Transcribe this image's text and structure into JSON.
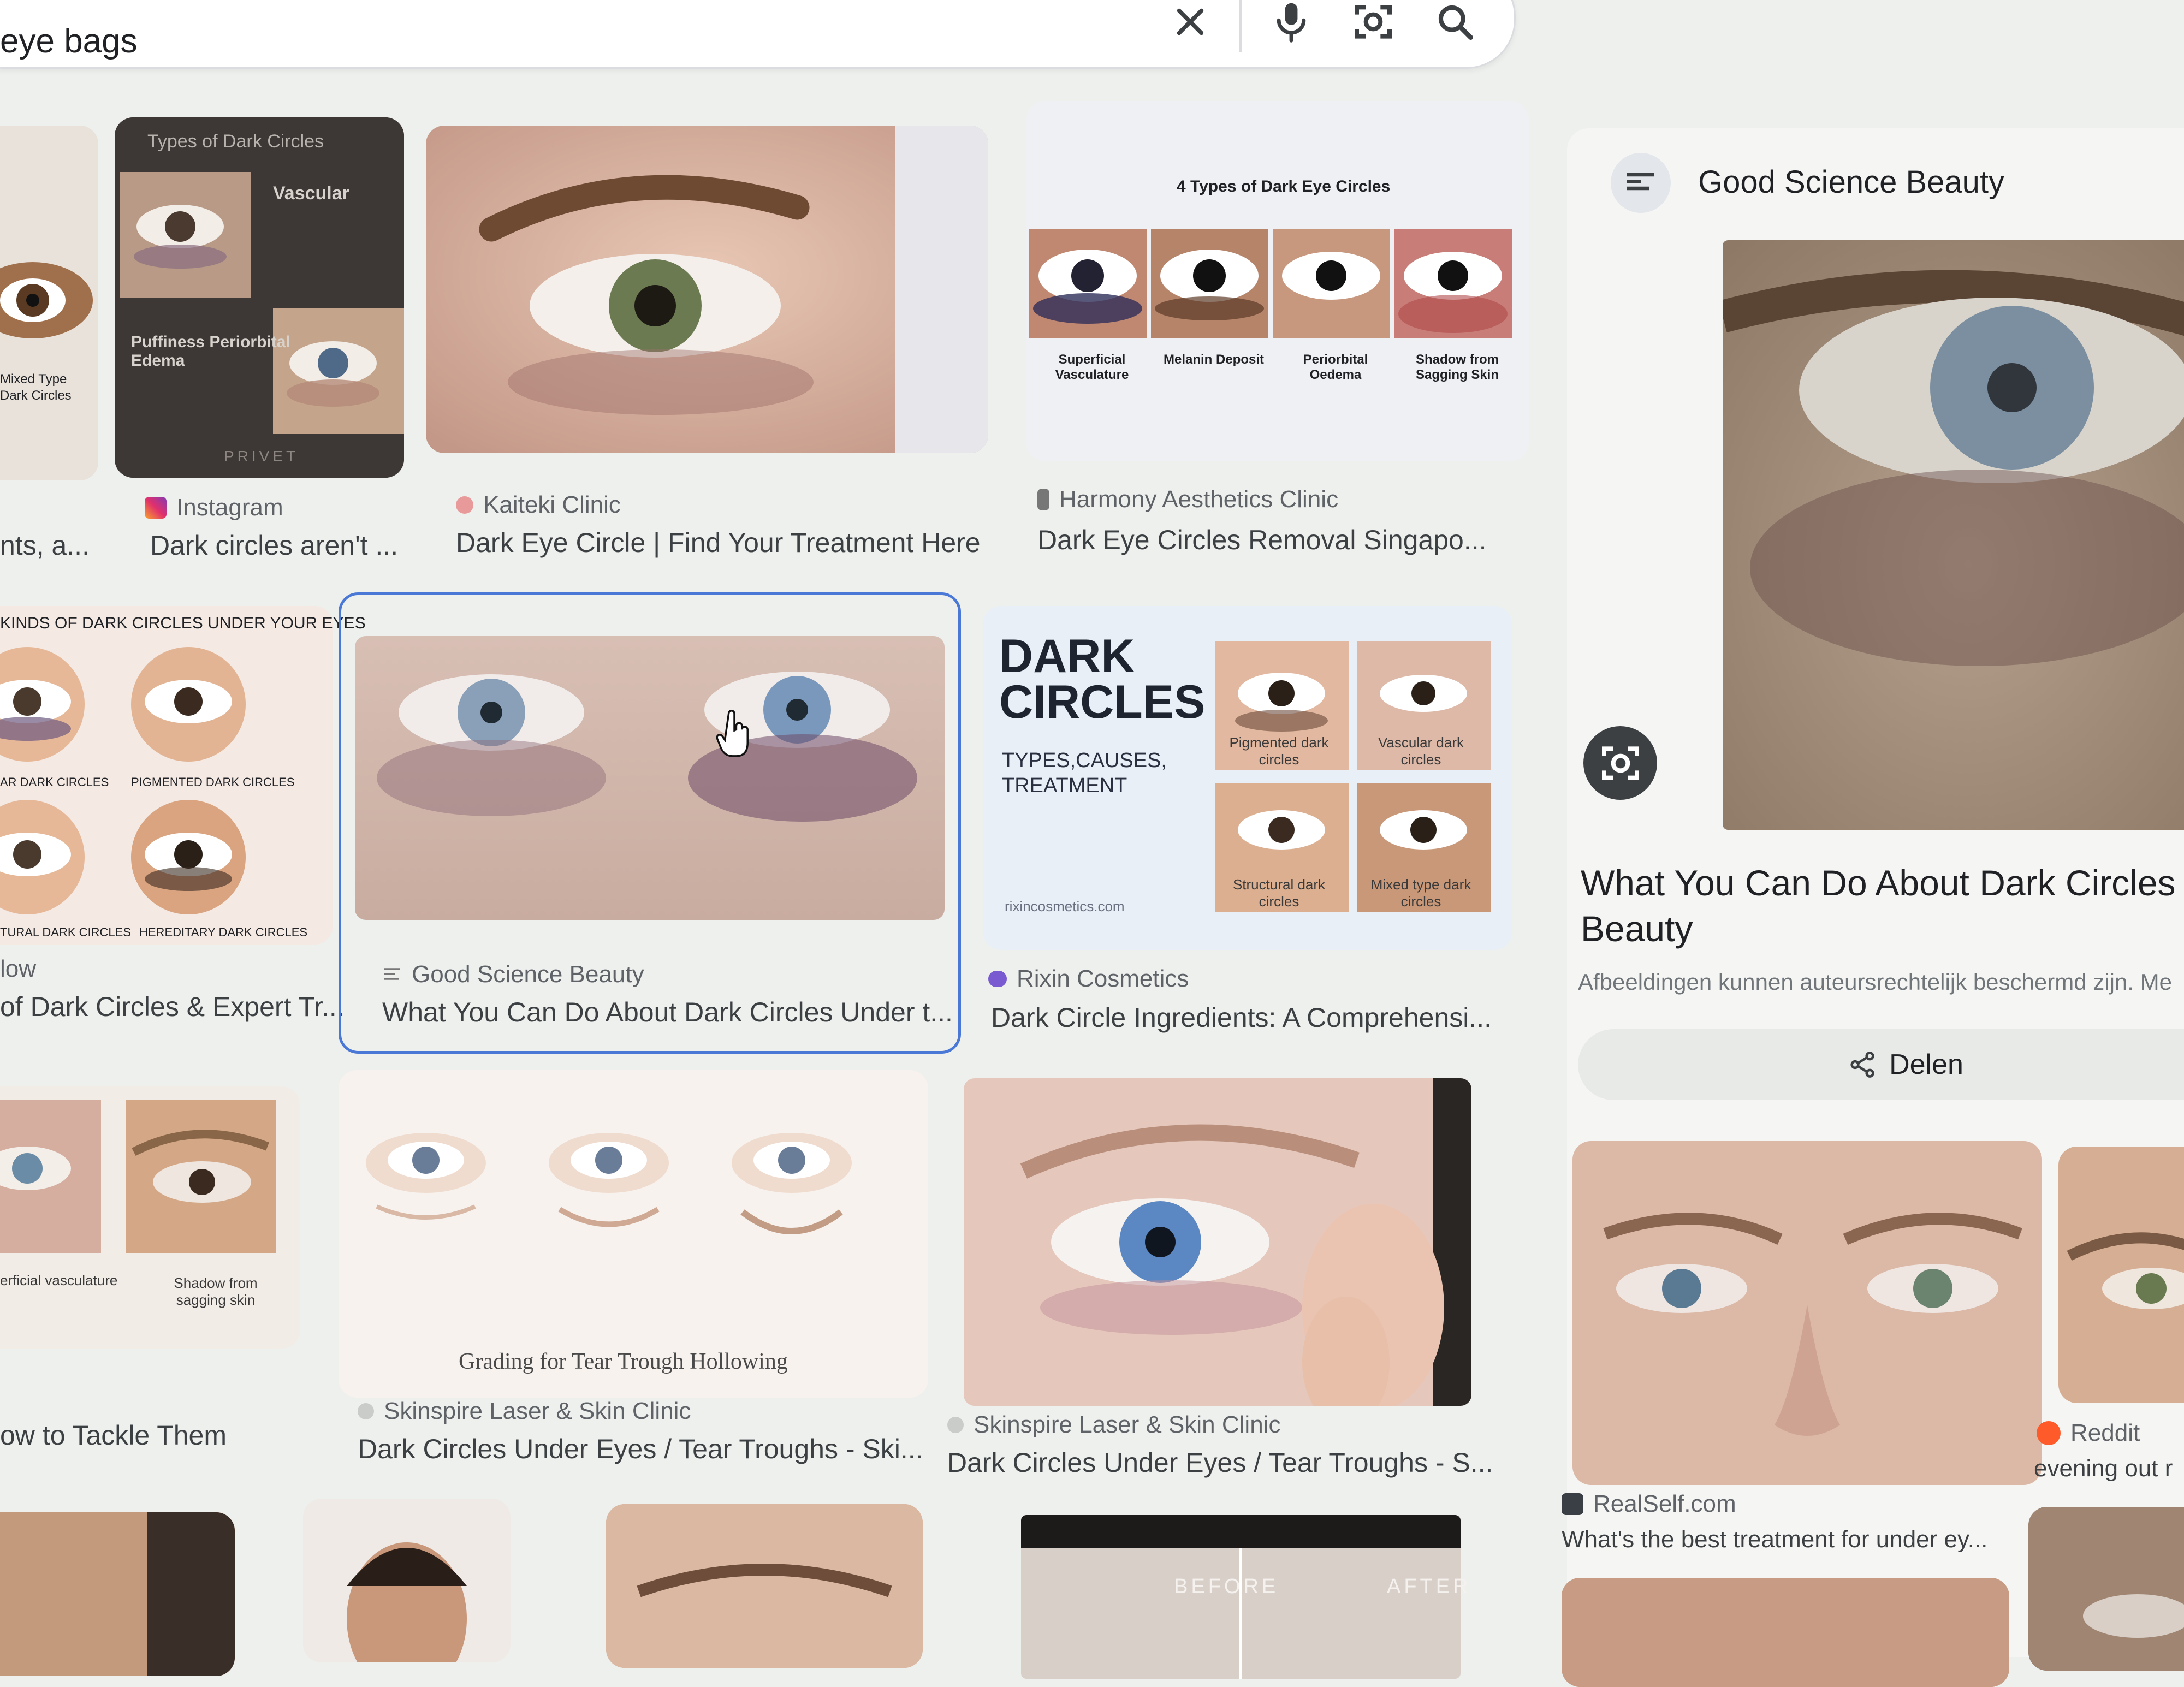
{
  "search": {
    "query": "eye bags",
    "icons": [
      "close-icon",
      "microphone-icon",
      "camera-lens-icon",
      "search-icon"
    ]
  },
  "results": [
    {
      "source": "",
      "title": "nts, a..."
    },
    {
      "source": "Instagram",
      "title": "Dark circles aren't ..."
    },
    {
      "source": "Kaiteki Clinic",
      "title": "Dark Eye Circle | Find Your Treatment Here"
    },
    {
      "source": "Harmony Aesthetics Clinic",
      "title": "Dark Eye Circles Removal Singapo..."
    },
    {
      "source": "low",
      "title": "of Dark Circles & Expert Tr..."
    },
    {
      "source": "Good Science Beauty",
      "title": "What You Can Do About Dark Circles Under t..."
    },
    {
      "source": "Rixin Cosmetics",
      "title": "Dark Circle Ingredients: A Comprehensi..."
    },
    {
      "source": "",
      "title": "ow to Tackle Them"
    },
    {
      "source": "Skinspire Laser & Skin Clinic",
      "title": "Dark Circles Under Eyes / Tear Troughs - Ski..."
    },
    {
      "source": "Skinspire Laser & Skin Clinic",
      "title": "Dark Circles Under Eyes / Tear Troughs - S..."
    },
    {
      "source": "RealSelf.com",
      "title": "What's the best treatment for under ey..."
    },
    {
      "source": "Reddit",
      "title": "evening out r"
    }
  ],
  "thumb_text": {
    "types_title": "Types of Dark Circles",
    "vascular": "Vascular",
    "puffiness": "Puffiness Periorbital Edema",
    "mixed": "Mixed Type Dark Circles",
    "privet": "PRIVET",
    "four_types": "4 Types of Dark Eye Circles",
    "four_labels": [
      "Superficial Vasculature",
      "Melanin Deposit",
      "Periorbital Oedema",
      "Shadow from Sagging Skin"
    ],
    "kinds": "KINDS OF DARK CIRCLES UNDER YOUR EYES",
    "kinds_labels": [
      "AR DARK CIRCLES",
      "PIGMENTED DARK CIRCLES",
      "TURAL DARK CIRCLES",
      "HEREDITARY DARK CIRCLES"
    ],
    "dark": "DARK",
    "circles": "CIRCLES",
    "types_causes": "TYPES,CAUSES,",
    "treatment": "TREATMENT",
    "rixin_labels": [
      "Pigmented dark circles",
      "Vascular dark circles",
      "Structural dark circles",
      "Mixed type dark circles"
    ],
    "rixin_url": "rixincosmetics.com",
    "vasc_label": "erficial vasculature",
    "shadow_label": "Shadow from sagging skin",
    "grading": "Grading for Tear Trough Hollowing",
    "before": "BEFORE",
    "after": "AFTER"
  },
  "panel": {
    "source": "Good Science Beauty",
    "title_line1": "What You Can Do About Dark Circles U",
    "title_line2": "Beauty",
    "copyright": "Afbeeldingen kunnen auteursrechtelijk beschermd zijn. Me",
    "share_label": "Delen"
  },
  "colors": {
    "selection": "#4a78d6",
    "background": "#eef0ee"
  }
}
